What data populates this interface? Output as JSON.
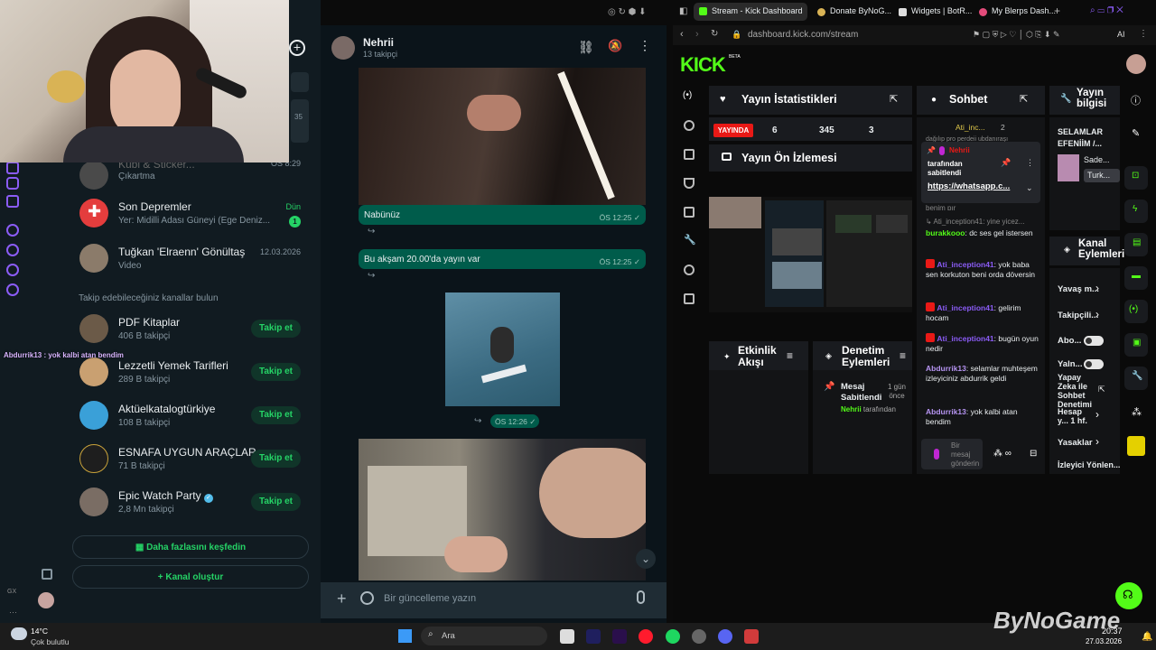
{
  "whatsapp": {
    "rail_badge": "GX",
    "partial_time": "35",
    "header_channel": {
      "name": "Nehrii",
      "followers": "13 takipçi"
    },
    "list_items": [
      {
        "name": "Kübi & Sticker...",
        "sub": "Çıkartma",
        "time": "ÖS 8:29"
      },
      {
        "name": "Son Depremler",
        "sub": "Yer: Midilli Adası Güneyi (Ege Deniz...",
        "time": "Dün",
        "badge": "1"
      },
      {
        "name": "Tuğkan 'Elraenn' Gönültaş",
        "sub": "Video",
        "time": "12.03.2026"
      }
    ],
    "suggest_heading": "Takip edebileceğiniz kanallar bulun",
    "suggestions": [
      {
        "name": "PDF Kitaplar",
        "followers": "406 B takipçi",
        "button": "Takip et"
      },
      {
        "name": "Lezzetli Yemek Tarifleri",
        "followers": "289 B takipçi",
        "button": "Takip et"
      },
      {
        "name": "Aktüelkatalogtürkiye",
        "followers": "108 B takipçi",
        "button": "Takip et"
      },
      {
        "name": "ESNAFA UYGUN ARAÇLAR",
        "followers": "71 B takipçi",
        "button": "Takip et"
      },
      {
        "name": "Epic Watch Party",
        "followers": "2,8 Mn takipçi",
        "button": "Takip et"
      }
    ],
    "discover_more": "Daha fazlasını keşfedin",
    "create_channel": "Kanal oluştur",
    "overlay_message": "Abdurrik13 : yok kalbi atan bendim",
    "messages": [
      {
        "text": "Nabünüz",
        "time": "ÖS 12:25 ✓"
      },
      {
        "text": "Bu akşam 20.00'da yayın var",
        "time": "ÖS 12:25 ✓"
      },
      {
        "text": "",
        "time": "ÖS 12:26 ✓"
      }
    ],
    "composer_placeholder": "Bir güncelleme yazın"
  },
  "browser": {
    "tabs": [
      "Stream - Kick Dashboard",
      "Donate ByNoG...",
      "Widgets | BotR...",
      "My Blerps Dash..."
    ],
    "url": "dashboard.kick.com/stream",
    "ai_label": "AI"
  },
  "kick": {
    "logo": "KICK",
    "logo_badge": "BETA",
    "stats": {
      "title": "Yayın İstatistikleri",
      "live": "YAYINDA",
      "viewers": "6",
      "followers": "345",
      "subs": "3"
    },
    "preview_title": "Yayın Ön İzlemesi",
    "chat": {
      "title": "Sohbet",
      "top_user": "Ati_inc...",
      "top_count": "2",
      "cut_line": "dağılıp pro perdeii ubdanıraşı",
      "pinned_by": "Nehrii",
      "pinned_label": "tarafından sabitlendi",
      "pinned_link": "https://whatsapp.c...",
      "cut_line2": "benim pır",
      "reply_hint": "Ati_inception41: yine yicez...",
      "lines": [
        {
          "user": "burakkooo",
          "text": "dc ses gel istersen",
          "color": "#53fc18"
        },
        {
          "user": "Ati_inception41",
          "text": "yok baba sen korkuton beni orda döversin",
          "color": "#8b5cf6"
        },
        {
          "user": "Ati_inception41",
          "text": "gelirim hocam",
          "color": "#8b5cf6"
        },
        {
          "user": "Ati_inception41",
          "text": "bugün oyun nedir",
          "color": "#8b5cf6"
        },
        {
          "user": "Abdurrik13",
          "text": "selamlar muhteşem izleyiciniz abdurrik geldi",
          "color": "#b694f2"
        },
        {
          "user": "Abdurrik13",
          "text": "yok kalbi atan bendim",
          "color": "#b694f2"
        }
      ],
      "input_placeholder": "Bir mesaj gönderin"
    },
    "stream_info": {
      "title": "Yayın bilgisi",
      "stream_title": "SELAMLAR EFENİİM /...",
      "category_1": "Sade...",
      "category_2": "Turk..."
    },
    "activity_title": "Etkinlik Akışı",
    "moderation": {
      "title": "Denetim Eylemleri",
      "action": "Mesaj Sabitlendi",
      "actor": "Nehrii",
      "actor_suffix": "tarafından",
      "time": "1 gün önce"
    },
    "channel_actions": {
      "title": "Kanal Eylemleri",
      "items": [
        "Yavaş m...",
        "Takipçili...",
        "Abo...",
        "Yaln...",
        "Yapay Zeka ile Sohbet Denetimi",
        "Hesap y... 1 hf.",
        "Yasaklar",
        "İzleyici Yönlen..."
      ]
    }
  },
  "taskbar": {
    "weather_temp": "14°C",
    "weather_desc": "Çok bulutlu",
    "search_placeholder": "Ara",
    "clock_time": "20:37",
    "clock_date": "27.03.2026",
    "watermark": "ByNoGame"
  },
  "colors": {
    "kick_green": "#53fc18",
    "wa_green": "#25d366",
    "wa_bubble": "#005c4b",
    "live_red": "#e91916"
  }
}
